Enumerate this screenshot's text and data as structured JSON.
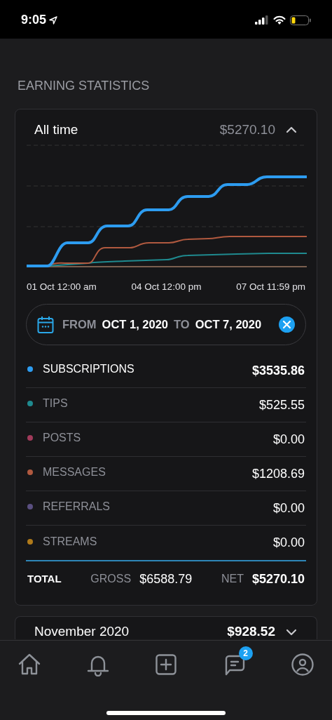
{
  "status_bar": {
    "time": "9:05"
  },
  "section_title": "EARNING STATISTICS",
  "summary_card": {
    "title": "All time",
    "amount": "$5270.10",
    "expanded": true,
    "axis_labels": [
      "01 Oct 12:00 am",
      "04 Oct 12:00 pm",
      "07 Oct 11:59 pm"
    ],
    "date_range": {
      "from_label": "FROM",
      "from": "OCT 1, 2020",
      "to_label": "TO",
      "to": "OCT 7, 2020"
    },
    "categories": [
      {
        "label": "SUBSCRIPTIONS",
        "amount": "$3535.86",
        "color": "#2d9cf0",
        "active": true
      },
      {
        "label": "TIPS",
        "amount": "$525.55",
        "color": "#1f8a8f",
        "active": false
      },
      {
        "label": "POSTS",
        "amount": "$0.00",
        "color": "#a03a5a",
        "active": false
      },
      {
        "label": "MESSAGES",
        "amount": "$1208.69",
        "color": "#b0593f",
        "active": false
      },
      {
        "label": "REFERRALS",
        "amount": "$0.00",
        "color": "#5a4f80",
        "active": false
      },
      {
        "label": "STREAMS",
        "amount": "$0.00",
        "color": "#b07a1a",
        "active": false
      }
    ],
    "total": {
      "label": "TOTAL",
      "gross_label": "GROSS",
      "gross": "$6588.79",
      "net_label": "NET",
      "net": "$5270.10"
    }
  },
  "month_cards": [
    {
      "title": "November 2020",
      "amount": "$928.52",
      "expanded": false
    }
  ],
  "tab_bar": {
    "items": [
      {
        "kind": "home"
      },
      {
        "kind": "notifications"
      },
      {
        "kind": "add"
      },
      {
        "kind": "messages",
        "badge": "2"
      },
      {
        "kind": "profile"
      }
    ]
  }
}
